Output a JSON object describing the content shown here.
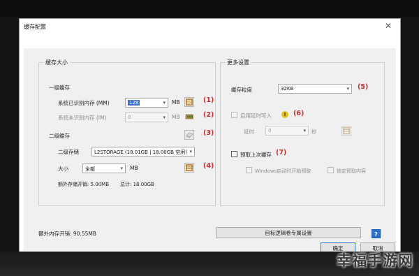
{
  "dialog": {
    "title": "缓存配置",
    "close_glyph": "✕"
  },
  "cache_size": {
    "group_title": "缓存大小",
    "l1": {
      "heading": "一级缓存",
      "recognized_label": "系统已识别内存 (MM)",
      "recognized_value": "128",
      "recognized_unit": "MB",
      "recognized_marker": "(1)",
      "unrecognized_label": "系统未识别内存 (IM)",
      "unrecognized_value": "0",
      "unrecognized_unit": "MB",
      "unrecognized_marker": "(2)"
    },
    "l2": {
      "heading": "二级缓存",
      "heading_marker": "(3)",
      "storage_label": "二级存储",
      "storage_value": "L2STORAGE (18.01GB | 18.00GB 空闲)",
      "size_label": "大小",
      "size_value": "全部",
      "size_unit": "MB",
      "size_marker": "(4)",
      "overhead": "额外存储开销: 5.00MB",
      "total": "总计: 18.00GB"
    }
  },
  "more_settings": {
    "group_title": "更多设置",
    "granularity_label": "缓存粒度",
    "granularity_value": "32KB",
    "granularity_marker": "(5)",
    "defer_write_label": "启用延时写入",
    "defer_write_checked": false,
    "defer_write_enabled": false,
    "defer_write_marker": "(6)",
    "delay_label": "延时",
    "delay_value": "0",
    "delay_unit": "秒",
    "prefetch_label": "预取上次缓存",
    "prefetch_checked": false,
    "prefetch_marker": "(7)",
    "prefetch_on_boot_label": "Windows启动时开始预取",
    "lock_prefetch_label": "锁定预取内容"
  },
  "footer": {
    "extra_memory": "额外内存开销: 90.55MB",
    "target_volume_button": "目标逻辑卷专属设置",
    "help_glyph": "?",
    "ok_button": "确定",
    "cancel_button": "取消"
  },
  "watermark": {
    "text": "幸福手游网"
  },
  "colors": {
    "marker_red": "#d12b2b",
    "selection_blue": "#3b73d8",
    "help_blue": "#2f6fcf",
    "warning_yellow": "#e8c420"
  },
  "icons": {
    "settings_icon": "options-list-icon",
    "unrecognized_icon": "memory-chip-icon",
    "l2_icon": "storage-drive-icon",
    "size_icon": "options-list-icon",
    "warning_icon": "warning-icon",
    "delay_icon": "options-list-icon"
  }
}
